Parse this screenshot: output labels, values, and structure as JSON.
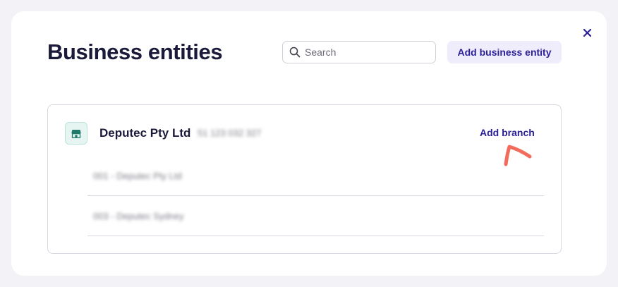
{
  "modal": {
    "title": "Business entities",
    "close_icon": "close-icon",
    "search": {
      "placeholder": "Search",
      "icon": "search-icon"
    },
    "add_entity_label": "Add business entity"
  },
  "entity": {
    "name": "Deputec Pty Ltd",
    "abn": "51 123 032 327",
    "icon": "store-icon",
    "add_branch_label": "Add branch",
    "branches": [
      {
        "label": "001 - Deputec Pty Ltd"
      },
      {
        "label": "003 - Deputec Sydney"
      }
    ]
  },
  "annotation": {
    "icon": "hand-drawn-arrow-icon",
    "color": "#f26b5b"
  },
  "colors": {
    "accent": "#2b1f95",
    "accent_bg": "#efedfb",
    "title": "#1b1a3a",
    "entity_icon": "#1f7a6b"
  }
}
